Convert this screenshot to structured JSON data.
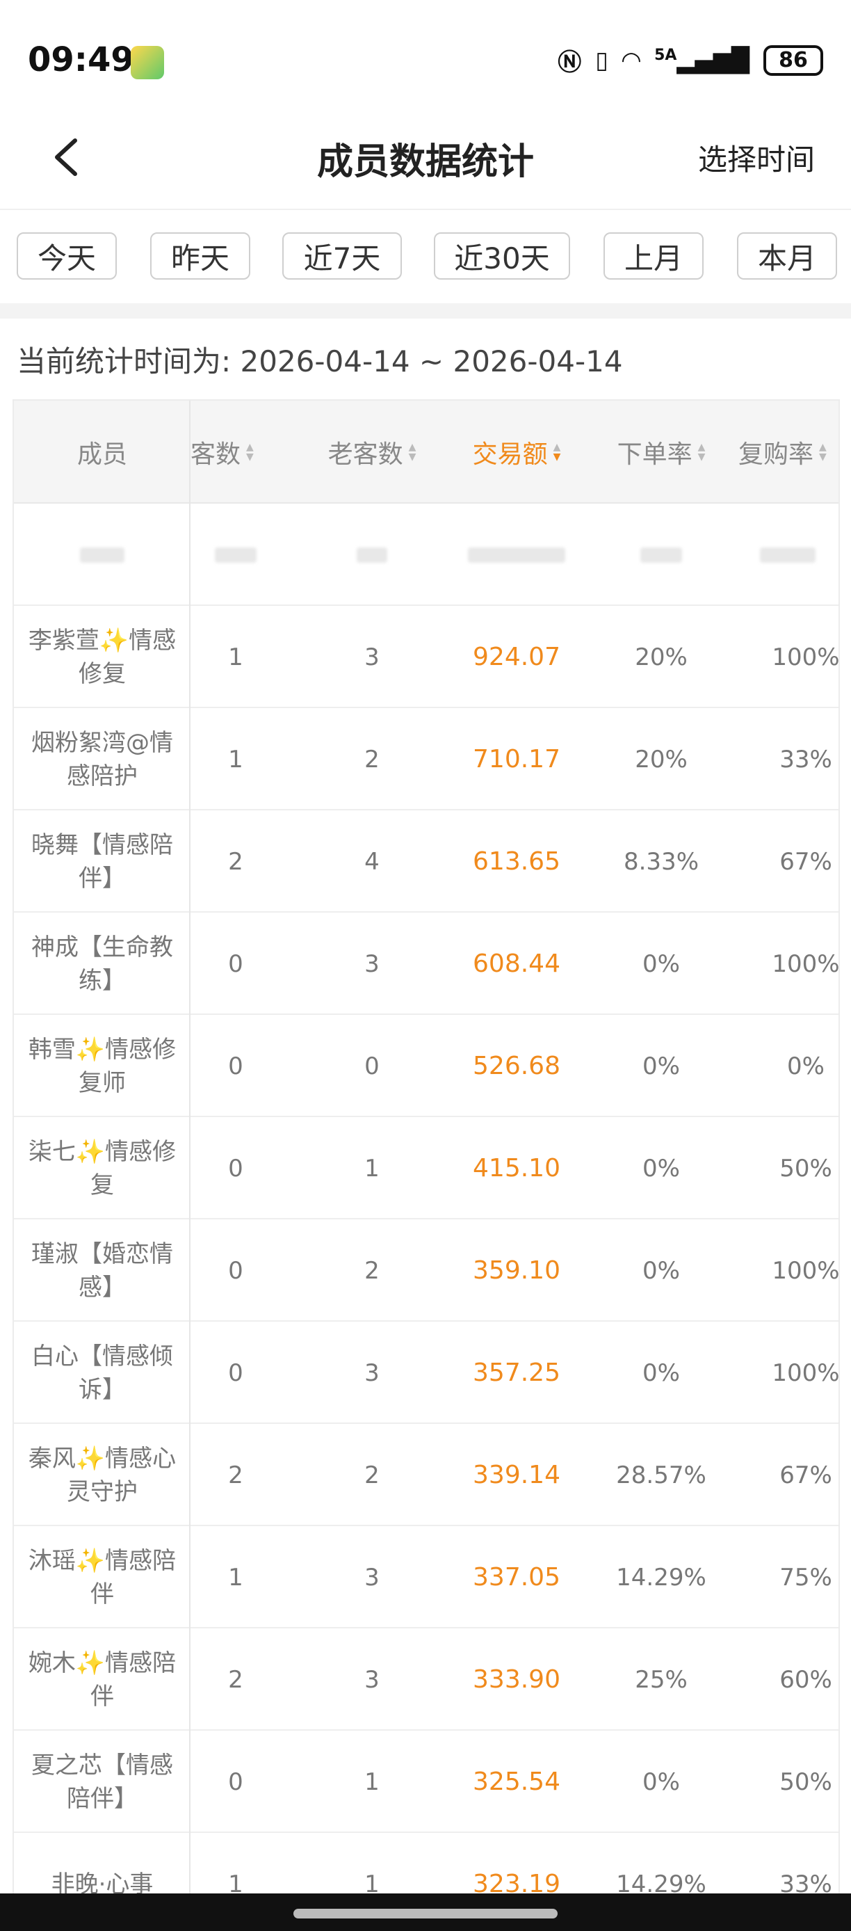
{
  "status_bar": {
    "time": "09:49",
    "battery": "86",
    "network": "5A"
  },
  "header": {
    "title": "成员数据统计",
    "action": "选择时间"
  },
  "filters": [
    "今天",
    "昨天",
    "近7天",
    "近30天",
    "上月",
    "本月"
  ],
  "range_text": "当前统计时间为: 2026-04-14 ~ 2026-04-14",
  "table": {
    "columns": [
      "成员",
      "新客数",
      "老客数",
      "交易额",
      "下单率",
      "复购率"
    ],
    "active_sort_column": "交易额",
    "rows": [
      {
        "name": "李紫萱✨情感修复",
        "new": "1",
        "old": "3",
        "amount": "924.07",
        "order_rate": "20%",
        "repurchase": "100%"
      },
      {
        "name": "烟粉絮湾@情感陪护",
        "new": "1",
        "old": "2",
        "amount": "710.17",
        "order_rate": "20%",
        "repurchase": "33%"
      },
      {
        "name": "晓舞【情感陪伴】",
        "new": "2",
        "old": "4",
        "amount": "613.65",
        "order_rate": "8.33%",
        "repurchase": "67%"
      },
      {
        "name": "神成【生命教练】",
        "new": "0",
        "old": "3",
        "amount": "608.44",
        "order_rate": "0%",
        "repurchase": "100%"
      },
      {
        "name": "韩雪✨情感修复师",
        "new": "0",
        "old": "0",
        "amount": "526.68",
        "order_rate": "0%",
        "repurchase": "0%"
      },
      {
        "name": "柒七✨情感修复",
        "new": "0",
        "old": "1",
        "amount": "415.10",
        "order_rate": "0%",
        "repurchase": "50%"
      },
      {
        "name": "瑾淑【婚恋情感】",
        "new": "0",
        "old": "2",
        "amount": "359.10",
        "order_rate": "0%",
        "repurchase": "100%"
      },
      {
        "name": "白心【情感倾诉】",
        "new": "0",
        "old": "3",
        "amount": "357.25",
        "order_rate": "0%",
        "repurchase": "100%"
      },
      {
        "name": "秦风✨情感心灵守护",
        "new": "2",
        "old": "2",
        "amount": "339.14",
        "order_rate": "28.57%",
        "repurchase": "67%"
      },
      {
        "name": "沐瑶✨情感陪伴",
        "new": "1",
        "old": "3",
        "amount": "337.05",
        "order_rate": "14.29%",
        "repurchase": "75%"
      },
      {
        "name": "婉木✨情感陪伴",
        "new": "2",
        "old": "3",
        "amount": "333.90",
        "order_rate": "25%",
        "repurchase": "60%"
      },
      {
        "name": "夏之芯【情感陪伴】",
        "new": "0",
        "old": "1",
        "amount": "325.54",
        "order_rate": "0%",
        "repurchase": "50%"
      },
      {
        "name": "非晚·心事",
        "new": "1",
        "old": "1",
        "amount": "323.19",
        "order_rate": "14.29%",
        "repurchase": "33%"
      }
    ]
  },
  "colors": {
    "accent": "#f08a1c",
    "muted": "#888888"
  }
}
